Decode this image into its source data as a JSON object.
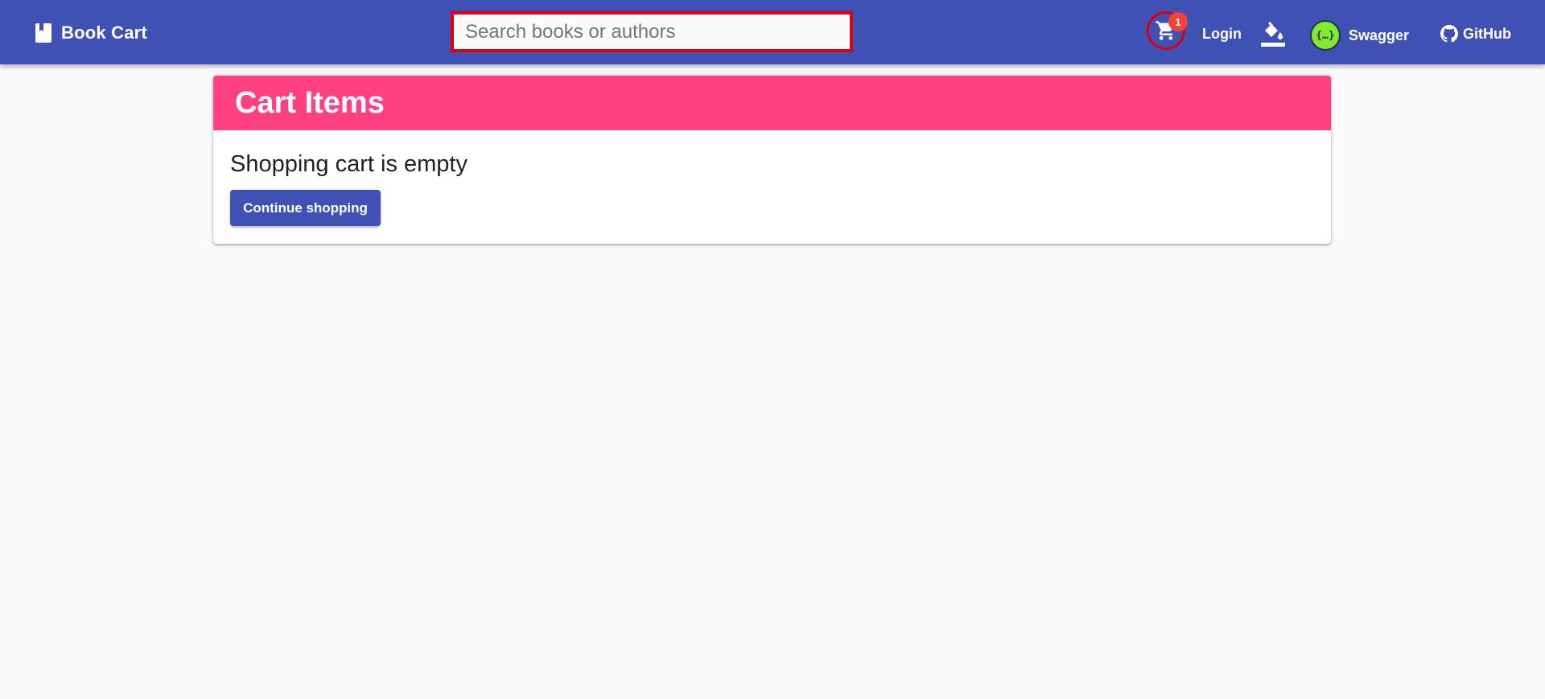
{
  "app": {
    "brand": "Book Cart"
  },
  "search": {
    "placeholder": "Search books or authors",
    "value": ""
  },
  "cart": {
    "count": "1"
  },
  "nav": {
    "login": "Login",
    "swagger": "Swagger",
    "github": "GitHub"
  },
  "icons": {
    "brand": "book-icon",
    "cart": "shopping-cart-icon",
    "theme": "paint-bucket-icon",
    "swagger": "swagger-logo-icon",
    "github": "github-icon"
  },
  "colors": {
    "toolbar": "#3f51b5",
    "card_header": "#ff4081",
    "badge": "#f44336",
    "button": "#3f51b5",
    "highlight_outline": "#e0000f",
    "swagger_logo": "#85ea2d"
  },
  "cart_page": {
    "title": "Cart Items",
    "empty_message": "Shopping cart is empty",
    "continue_button": "Continue shopping"
  }
}
